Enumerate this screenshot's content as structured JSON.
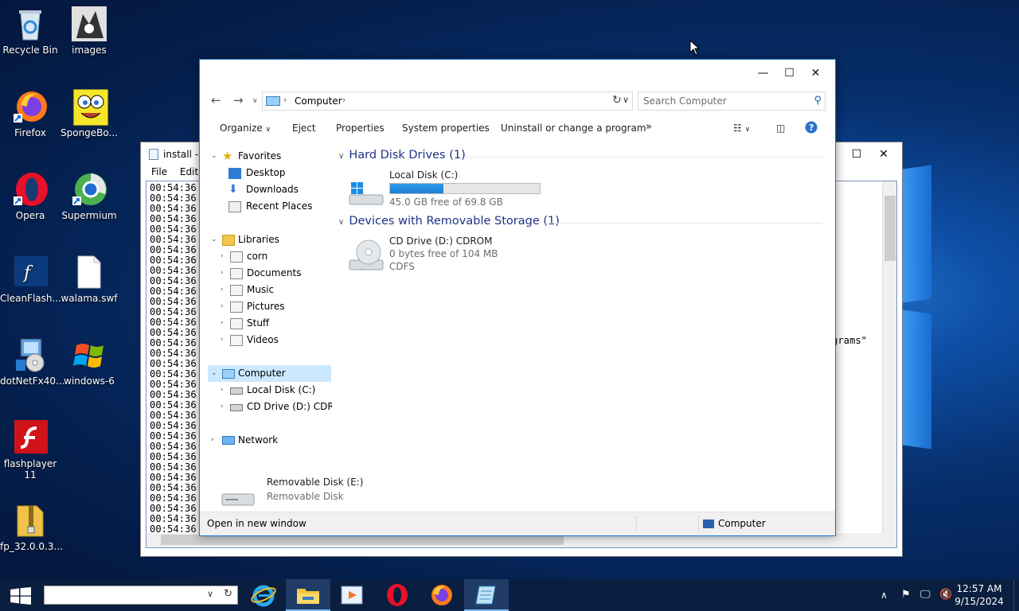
{
  "desktop": {
    "icons": [
      {
        "label": "Recycle Bin"
      },
      {
        "label": "images"
      },
      {
        "label": "Firefox"
      },
      {
        "label": "SpongeBo..."
      },
      {
        "label": "Opera"
      },
      {
        "label": "Supermium"
      },
      {
        "label": "CleanFlash..."
      },
      {
        "label": "walama.swf"
      },
      {
        "label": "dotNetFx40..."
      },
      {
        "label": "windows-6"
      },
      {
        "label": "flashplayer 11"
      },
      {
        "label": "fp_32.0.0.3..."
      }
    ]
  },
  "notepad": {
    "title": "install - N",
    "menu": {
      "file": "File",
      "edit": "Edit"
    },
    "line_text": "00:54:36",
    "right_fragment": "grams\""
  },
  "explorer": {
    "address": {
      "location": "Computer"
    },
    "search_placeholder": "Search Computer",
    "commands": {
      "organize": "Organize",
      "eject": "Eject",
      "properties": "Properties",
      "system_properties": "System properties",
      "uninstall": "Uninstall or change a program",
      "more": "»"
    },
    "tree": {
      "favorites": "Favorites",
      "desktop": "Desktop",
      "downloads": "Downloads",
      "recent_places": "Recent Places",
      "libraries": "Libraries",
      "corn": "corn",
      "documents": "Documents",
      "music": "Music",
      "pictures": "Pictures",
      "stuff": "Stuff",
      "videos": "Videos",
      "computer": "Computer",
      "local_disk": "Local Disk (C:)",
      "cd_drive": "CD Drive (D:) CDROM",
      "network": "Network"
    },
    "groups": {
      "hard_disk": "Hard Disk Drives (1)",
      "removable": "Devices with Removable Storage (1)"
    },
    "drives": {
      "c": {
        "name": "Local Disk (C:)",
        "free": "45.0 GB free of 69.8 GB",
        "used_fraction": 0.355
      },
      "d": {
        "name": "CD Drive (D:) CDROM",
        "free": "0 bytes free of 104 MB",
        "fs": "CDFS"
      },
      "e": {
        "name": "Removable Disk (E:)",
        "type": "Removable Disk"
      }
    },
    "status": {
      "left": "Open in new window",
      "right": "Computer"
    }
  },
  "taskbar": {
    "time": "12:57 AM",
    "date": "9/15/2024"
  }
}
